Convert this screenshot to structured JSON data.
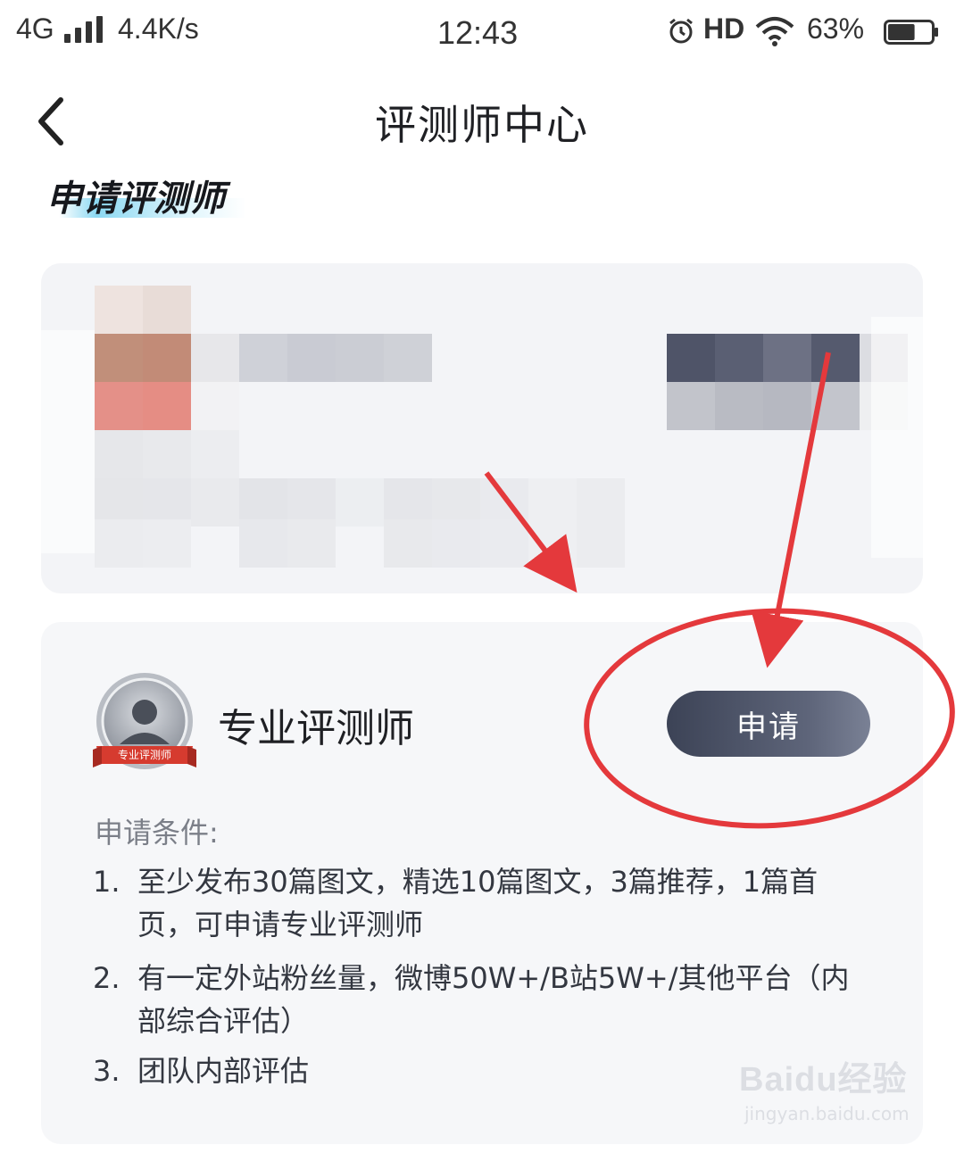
{
  "status_bar": {
    "network": "4G",
    "speed": "4.4K/s",
    "time": "12:43",
    "hd": "HD",
    "battery_percent": "63%",
    "battery_level": 0.63
  },
  "nav": {
    "title": "评测师中心"
  },
  "section": {
    "heading": "申请评测师"
  },
  "role_card": {
    "badge_ribbon": "专业评测师",
    "name": "专业评测师",
    "apply_label": "申请",
    "conditions_title": "申请条件:",
    "conditions": [
      {
        "num": "1.",
        "text": "至少发布30篇图文，精选10篇图文，3篇推荐，1篇首页，可申请专业评测师"
      },
      {
        "num": "2.",
        "text": "有一定外站粉丝量，微博50W+/B站5W+/其他平台（内部综合评估）"
      },
      {
        "num": "3.",
        "text": "团队内部评估"
      }
    ]
  },
  "watermark": {
    "brand": "Baidu经验",
    "url": "jingyan.baidu.com"
  },
  "colors": {
    "annotation_red": "#e4393c",
    "button_dark": "#3c4356",
    "card_bg": "#f6f7f9"
  }
}
